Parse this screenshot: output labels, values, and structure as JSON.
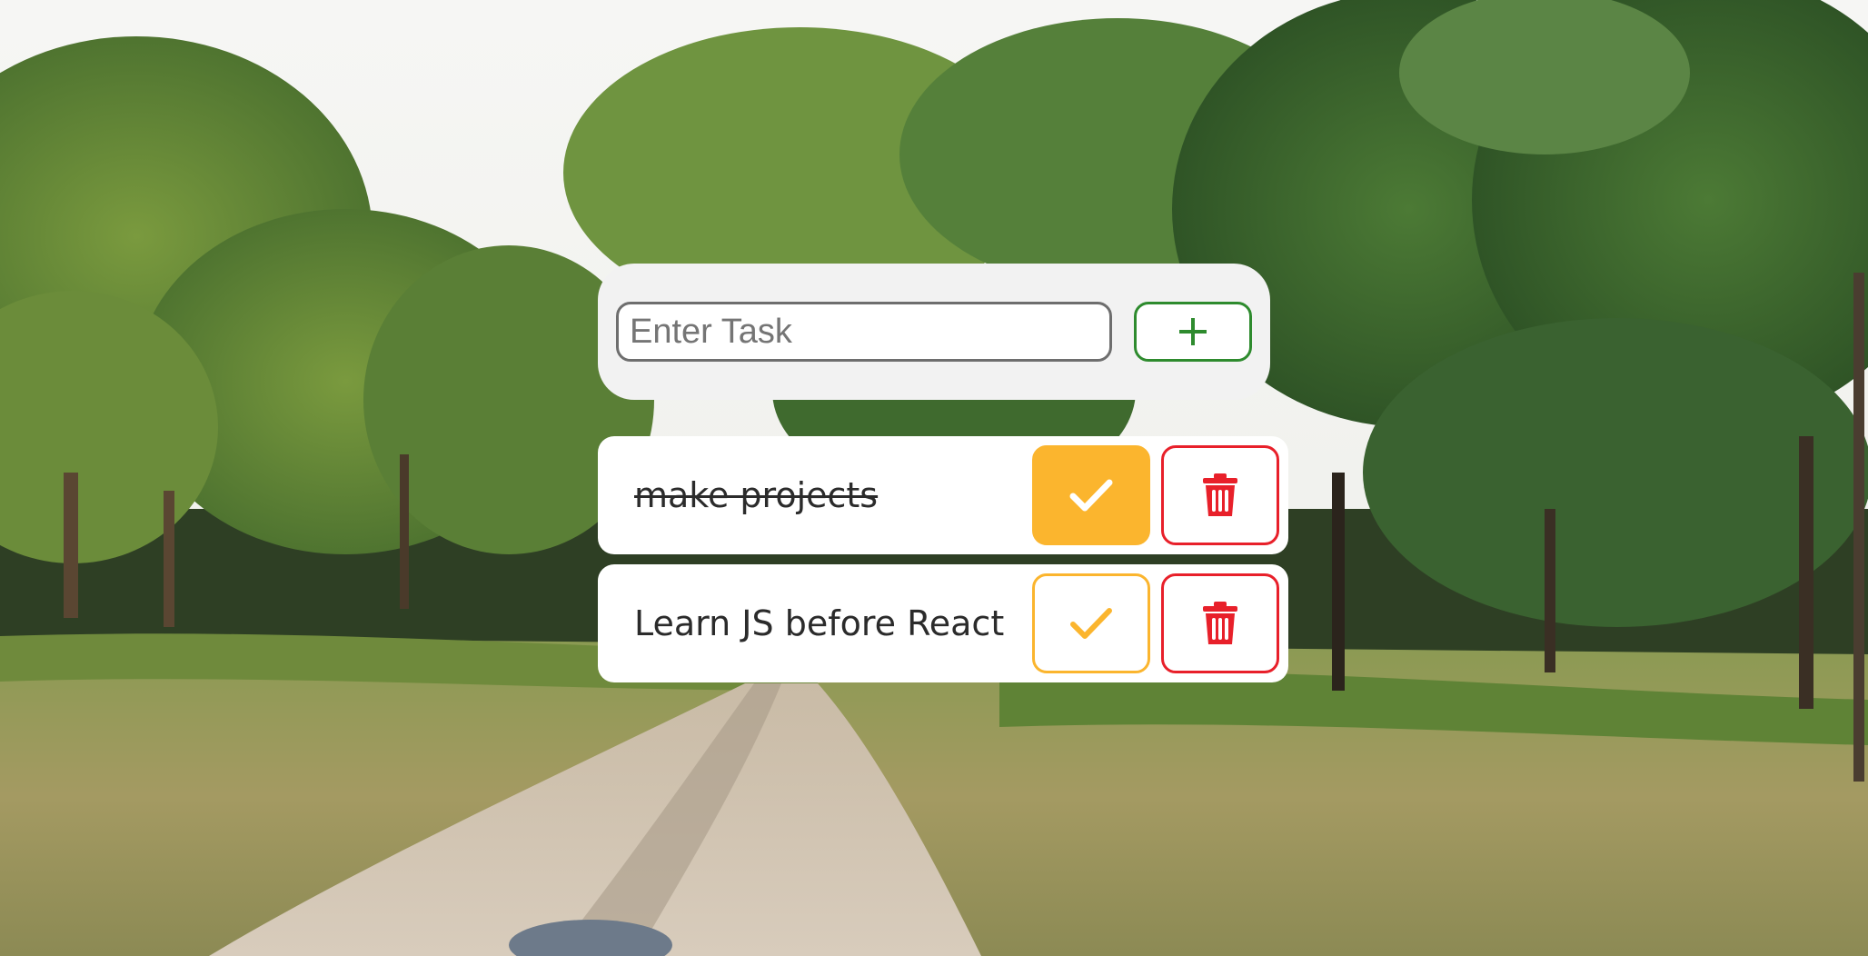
{
  "background": {
    "icon": "forest-path-photo"
  },
  "add_task": {
    "placeholder": "Enter Task",
    "value": "",
    "add_icon": "plus-icon",
    "add_color": "#2e8b2e"
  },
  "tasks": [
    {
      "text": "make projects",
      "completed": true,
      "complete_icon": "checkmark-icon",
      "delete_icon": "trash-icon"
    },
    {
      "text": "Learn JS before React",
      "completed": false,
      "complete_icon": "checkmark-icon",
      "delete_icon": "trash-icon"
    }
  ],
  "colors": {
    "complete_accent": "#fbb52e",
    "delete_accent": "#e8202a",
    "card_background": "#f2f2f2"
  }
}
